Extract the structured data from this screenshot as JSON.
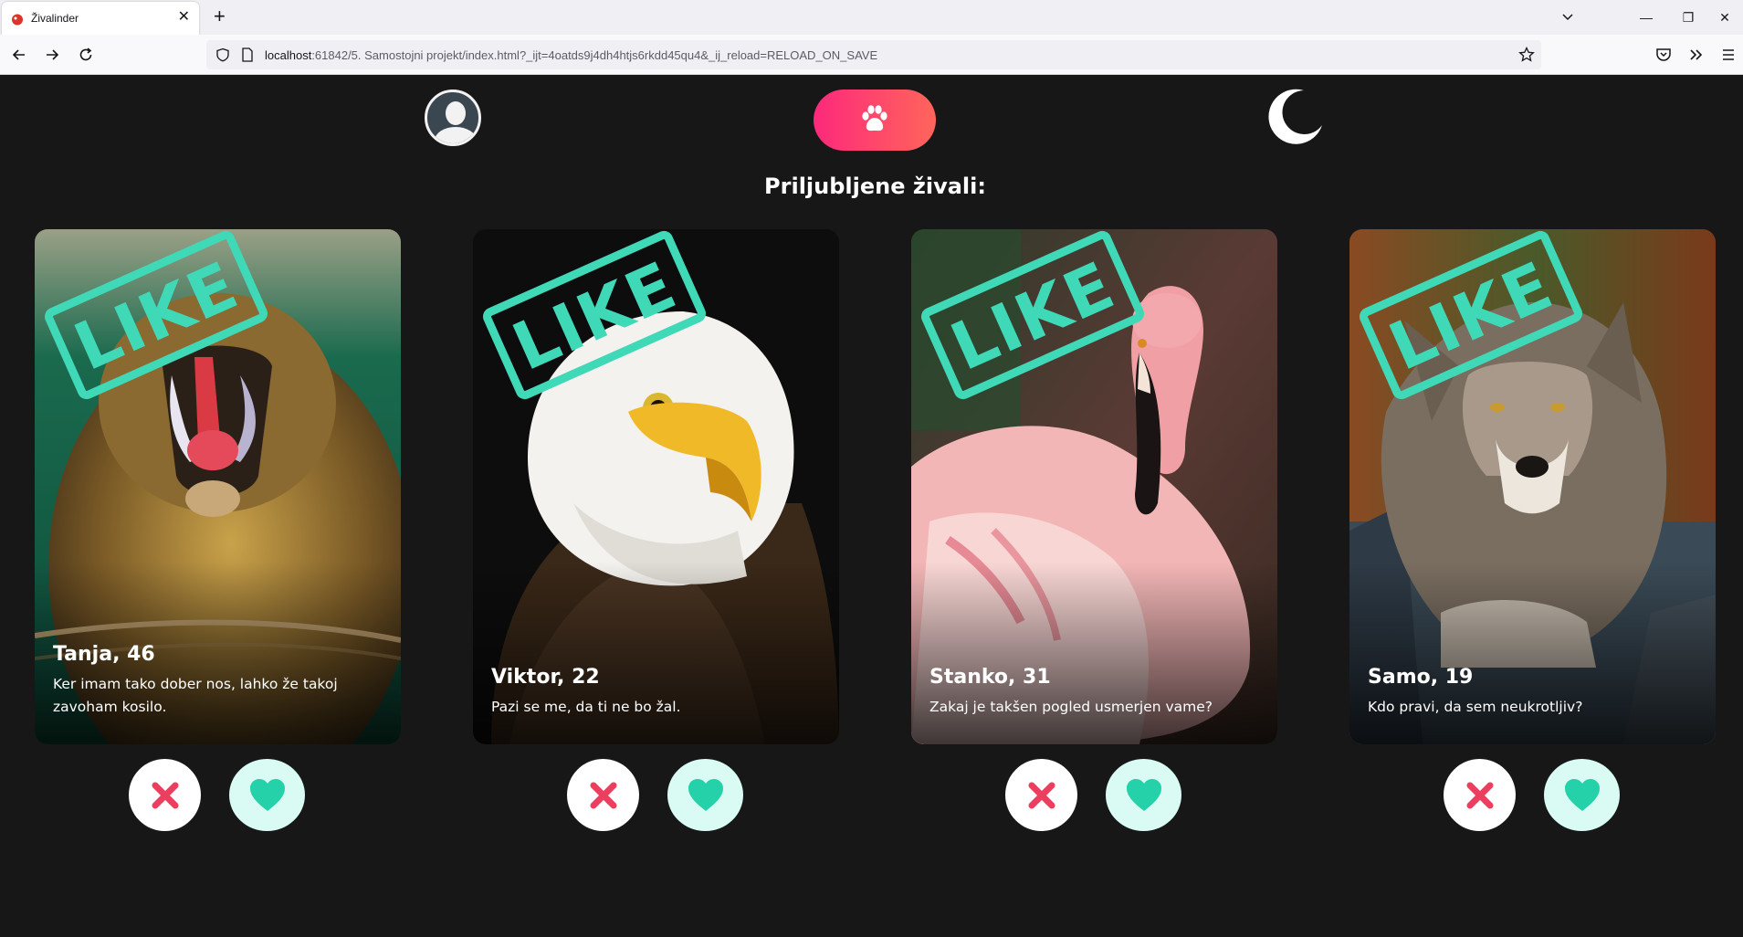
{
  "browser": {
    "tab_title": "Živalinder",
    "url_host": "localhost",
    "url_rest": ":61842/5. Samostojni projekt/index.html?_ijt=4oatds9j4dh4htjs6rkdd45qu4&_ij_reload=RELOAD_ON_SAVE"
  },
  "page": {
    "heading": "Priljubljene živali:",
    "stamp_label": "LIKE",
    "accent_color": "#fd297b",
    "like_color": "#40d9b8"
  },
  "cards": [
    {
      "name": "Tanja, 46",
      "description": "Ker imam tako dober nos, lahko že takoj zavoham kosilo.",
      "animal": "mandrill"
    },
    {
      "name": "Viktor, 22",
      "description": "Pazi se me, da ti ne bo žal.",
      "animal": "bald-eagle"
    },
    {
      "name": "Stanko, 31",
      "description": "Zakaj je takšen pogled usmerjen vame?",
      "animal": "flamingo"
    },
    {
      "name": "Samo, 19",
      "description": "Kdo pravi, da sem neukrotljiv?",
      "animal": "wolf"
    }
  ]
}
